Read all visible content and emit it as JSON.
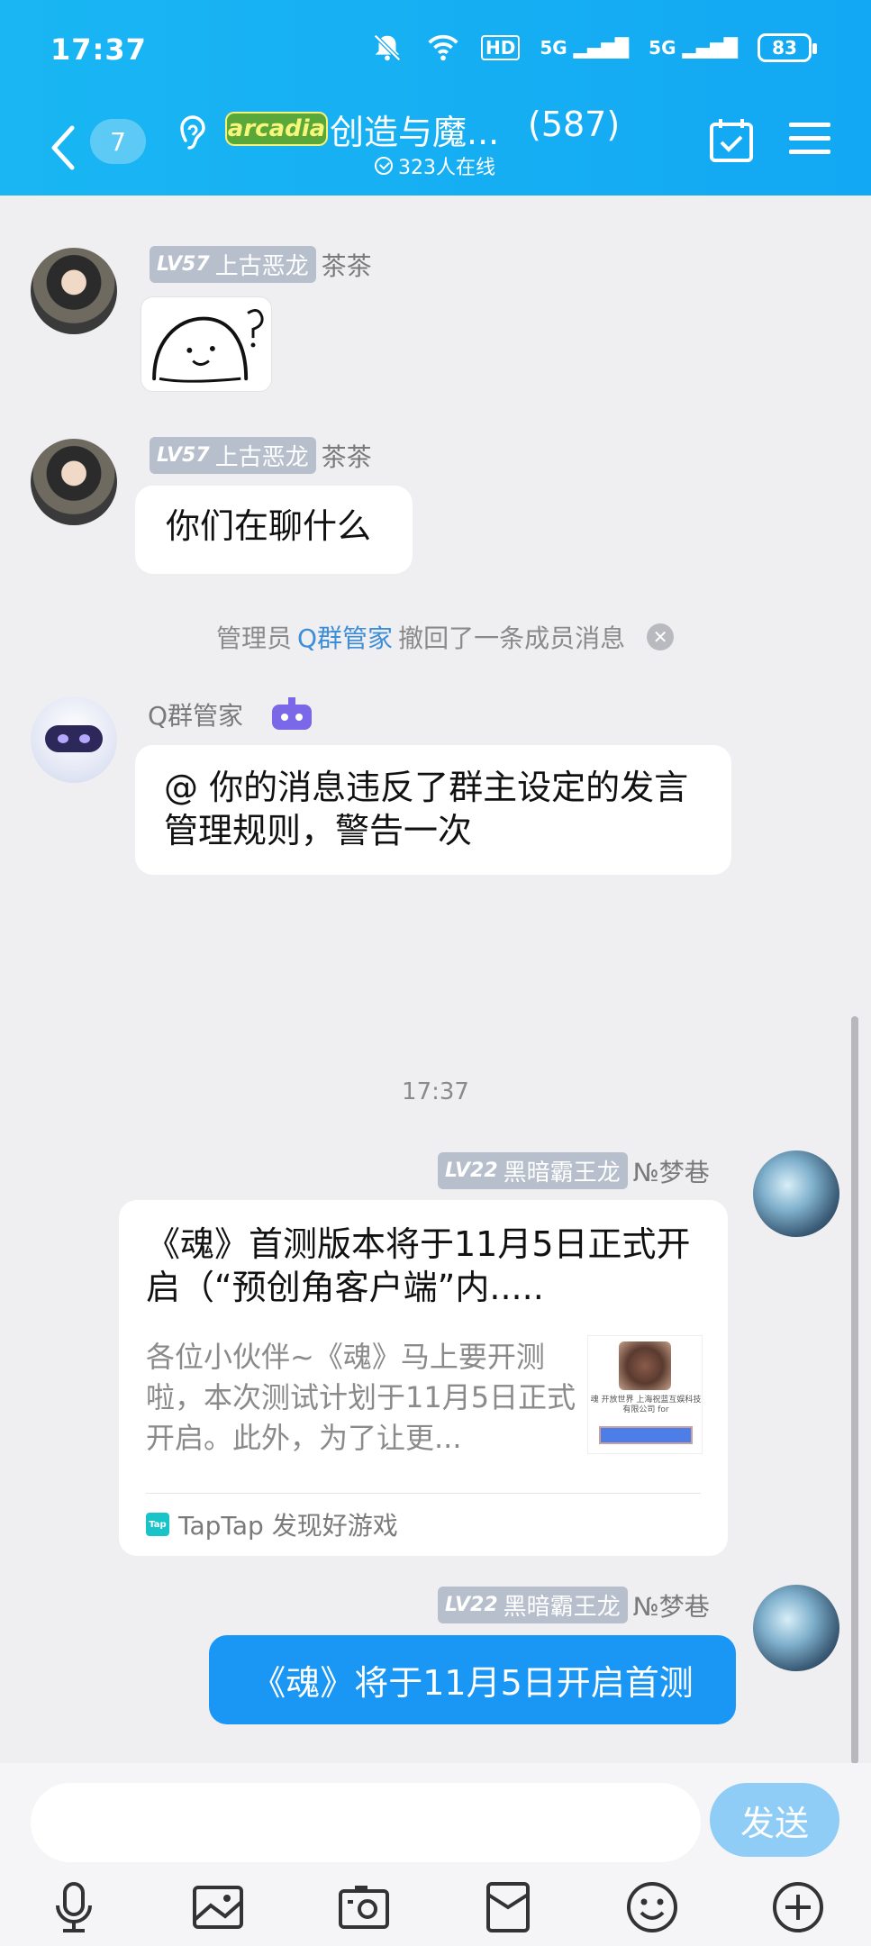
{
  "status_bar": {
    "time": "17:37",
    "battery": "83",
    "hd": "HD",
    "net1": "5G",
    "net2": "5G"
  },
  "nav": {
    "unread_count": "7",
    "logo_text": "arcadia",
    "group_title": "创造与魔...",
    "member_count": "(587)",
    "online": "323人在线"
  },
  "messages": [
    {
      "level": "LV57",
      "title": "上古恶龙",
      "name": "茶茶",
      "type": "sticker"
    },
    {
      "level": "LV57",
      "title": "上古恶龙",
      "name": "茶茶",
      "text": "你们在聊什么"
    }
  ],
  "system": {
    "prefix": "管理员",
    "who": "Q群管家",
    "suffix": "撤回了一条成员消息",
    "close": "✕"
  },
  "bot": {
    "name": "Q群管家",
    "text": "@ 你的消息违反了群主设定的发言管理规则，警告一次"
  },
  "timestamp": "17:37",
  "card_msg": {
    "level": "LV22",
    "title": "黑暗霸王龙",
    "name": "№梦巷",
    "card_title": "《魂》首测版本将于11月5日正式开启（“预创角客户端”内.....",
    "card_desc": "各位小伙伴~《魂》马上要开测啦，本次测试计划于11月5日正式开启。此外，为了让更...",
    "thumb_text": "魂 开放世界 上海祝蓝互娱科技有限公司 for ",
    "source_icon": "Tap",
    "source": "TapTap 发现好游戏"
  },
  "text_msg": {
    "level": "LV22",
    "title": "黑暗霸王龙",
    "name": "№梦巷",
    "text": "《魂》将于11月5日开启首测"
  },
  "input": {
    "placeholder": "",
    "send": "发送"
  },
  "toolbar": [
    "microphone-icon",
    "image-icon",
    "camera-icon",
    "red-packet-icon",
    "emoji-icon",
    "plus-icon"
  ]
}
